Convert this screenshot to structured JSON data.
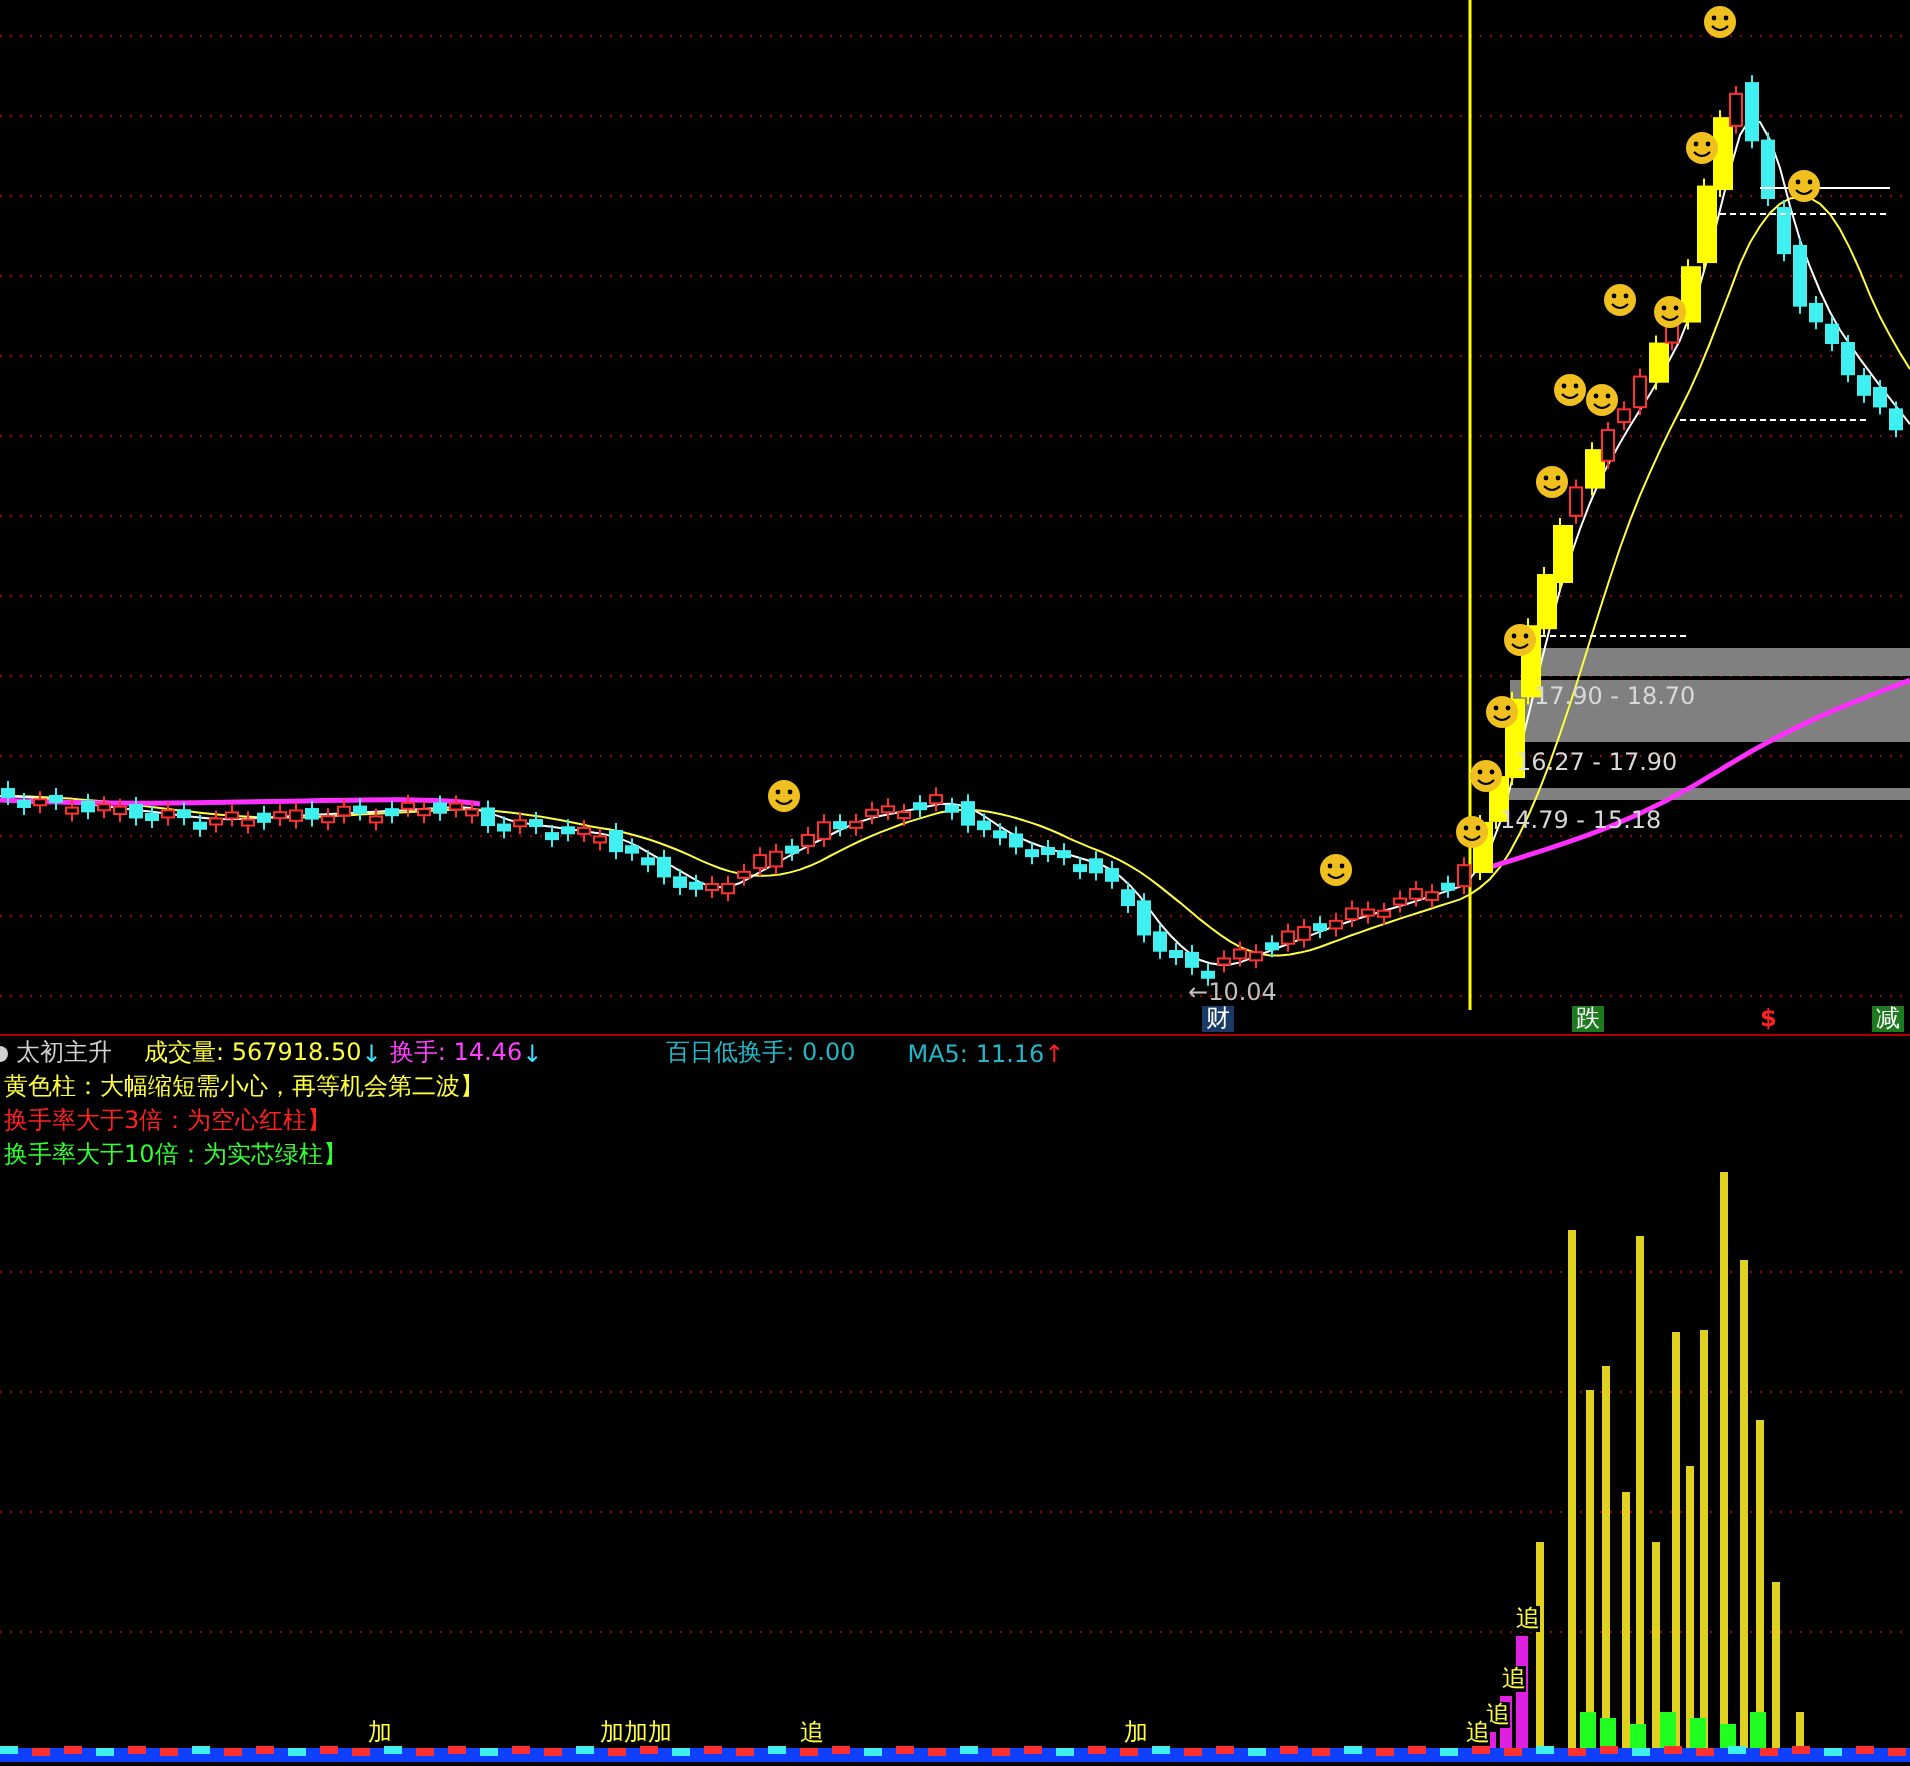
{
  "price_panel": {
    "low_label": "10.04",
    "low_arrow": "←",
    "zones": [
      "17.90 - 18.70",
      "16.27 - 17.90",
      "14.79 - 15.18"
    ],
    "markers": [
      {
        "text": "财",
        "kind": "tag",
        "color": "#1a3a66"
      },
      {
        "text": "跌",
        "kind": "tag",
        "color": "#1e7a1e"
      },
      {
        "text": "$",
        "kind": "text",
        "color": "#ff2020"
      },
      {
        "text": "减",
        "kind": "tag",
        "color": "#1e7a1e"
      }
    ]
  },
  "indicator": {
    "name": "太初主升",
    "fields": [
      {
        "label": "成交量:",
        "value": "567918.50",
        "arrow": "↓",
        "color": "#ffff40"
      },
      {
        "label": "换手:",
        "value": "14.46",
        "arrow": "↓",
        "color": "#ff40ff"
      },
      {
        "label": "百日低换手:",
        "value": "0.00",
        "color": "#20b8c8"
      },
      {
        "label": "MA5:",
        "value": "11.16",
        "arrow": "↑",
        "color": "#20b8c8"
      }
    ],
    "legend": [
      {
        "text": "黄色柱：大幅缩短需小心，再等机会第二波】",
        "color": "#ffff40"
      },
      {
        "text": "换手率大于3倍：为空心红柱】",
        "color": "#ff2020"
      },
      {
        "text": "换手率大于10倍：为实芯绿柱】",
        "color": "#30ff30"
      }
    ]
  },
  "volume_panel": {
    "signal_labels": [
      "加",
      "加",
      "加",
      "加",
      "追",
      "加",
      "追",
      "追",
      "追",
      "追"
    ]
  }
}
